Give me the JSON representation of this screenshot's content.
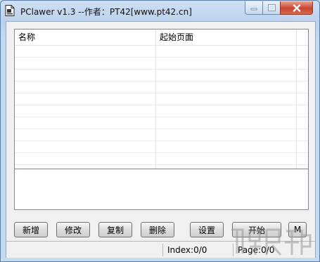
{
  "window": {
    "title": "PClawer v1.3 --作者：PT42[www.pt42.cn]",
    "icon": "document-icon"
  },
  "list": {
    "columns": [
      "名称",
      "起始页面"
    ]
  },
  "buttons": {
    "add": "新增",
    "edit": "修改",
    "copy": "复制",
    "delete": "删除",
    "settings": "设置",
    "start": "开始",
    "m": "M"
  },
  "status": {
    "index": "Index:0/0",
    "page": "Page:0/0"
  },
  "colors": {
    "close_button": "#c8452e",
    "frame": "#c9dcf0"
  }
}
